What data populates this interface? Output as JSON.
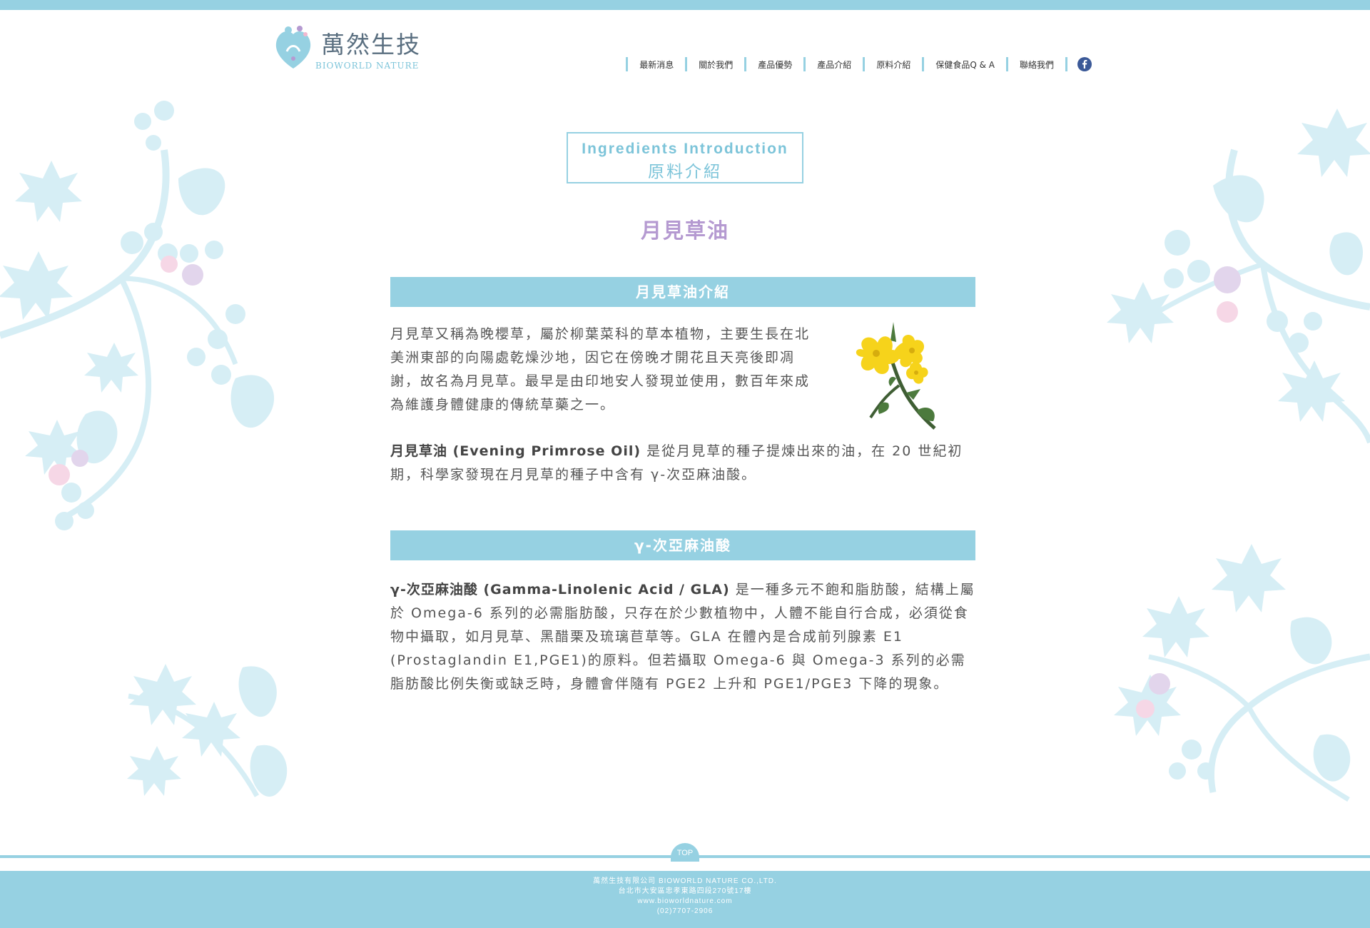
{
  "brand": {
    "name_cn": "萬然生技",
    "name_en": "BIOWORLD NATURE"
  },
  "nav": {
    "items": [
      "最新消息",
      "關於我們",
      "產品優勢",
      "產品介紹",
      "原料介紹",
      "保健食品Q & A",
      "聯絡我們"
    ],
    "social_icon": "facebook-icon"
  },
  "section": {
    "title_en": "Ingredients Introduction",
    "title_cn": "原料介紹"
  },
  "page_title": "月見草油",
  "intro": {
    "heading": "月見草油介紹",
    "paragraph1": "月見草又稱為晚櫻草，屬於柳葉菜科的草本植物，主要生長在北美洲東部的向陽處乾燥沙地，因它在傍晚才開花且天亮後即凋謝，故名為月見草。最早是由印地安人發現並使用，數百年來成為維護身體健康的傳統草藥之一。",
    "paragraph2_bold": "月見草油 (Evening Primrose Oil)",
    "paragraph2_rest": " 是從月見草的種子提煉出來的油，在 20 世紀初期，科學家發現在月見草的種子中含有 γ-次亞麻油酸。"
  },
  "gla": {
    "heading": "γ-次亞麻油酸",
    "paragraph_bold": "γ-次亞麻油酸 (Gamma-Linolenic Acid / GLA)",
    "paragraph_rest": " 是一種多元不飽和脂肪酸，結構上屬於 Omega-6 系列的必需脂肪酸，只存在於少數植物中，人體不能自行合成，必須從食物中攝取，如月見草、黑醋栗及琉璃苣草等。GLA 在體內是合成前列腺素 E1 (Prostaglandin E1,PGE1)的原料。但若攝取 Omega-6 與 Omega-3 系列的必需脂肪酸比例失衡或缺乏時，身體會伴隨有 PGE2 上升和 PGE1/PGE3 下降的現象。"
  },
  "footer": {
    "top_label": "TOP",
    "company": "萬然生技有限公司 BIOWORLD NATURE CO.,LTD.",
    "address": "台北市大安區忠孝東路四段270號17樓",
    "website": "www.bioworldnature.com",
    "phone": "(02)7707-2906"
  },
  "colors": {
    "accent": "#96d1e2",
    "title_purple": "#b59ad1",
    "decor_blue": "#d6eef5",
    "decor_pink": "#f6d7e6",
    "decor_purple": "#e2d5ec"
  }
}
